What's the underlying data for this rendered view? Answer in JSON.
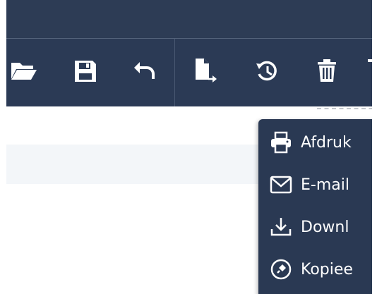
{
  "toolbar": {
    "buttons": [
      {
        "icon": "folder-open-icon"
      },
      {
        "icon": "save-icon"
      },
      {
        "icon": "undo-icon"
      },
      {
        "icon": "export-file-icon"
      },
      {
        "icon": "history-icon"
      },
      {
        "icon": "trash-icon"
      }
    ]
  },
  "menu": {
    "items": [
      {
        "label": "Afdruk",
        "icon": "printer-icon"
      },
      {
        "label": "E-mail",
        "icon": "envelope-icon"
      },
      {
        "label": "Downl",
        "icon": "download-icon"
      },
      {
        "label": "Kopiee",
        "icon": "pin-icon"
      }
    ]
  },
  "colors": {
    "toolbar_bg": "#2b3a55",
    "header_bg": "#2d3c55",
    "menu_bg": "#2a3953",
    "icon_white": "#ffffff",
    "content_band": "#f3f6f9"
  }
}
